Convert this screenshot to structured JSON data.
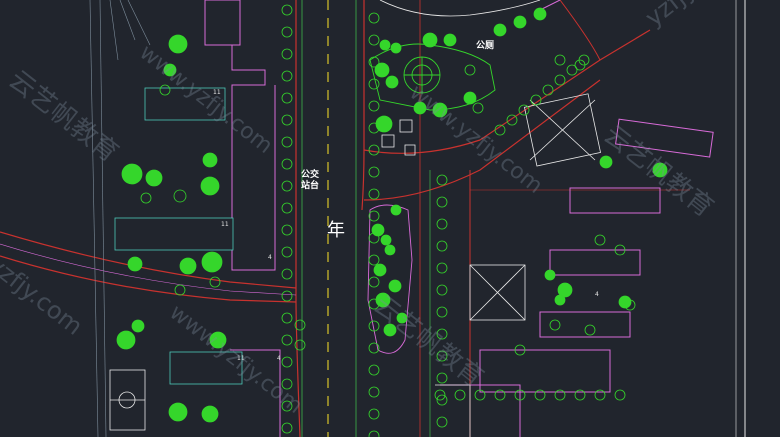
{
  "labels": {
    "bus_stop_line1": "公交",
    "bus_stop_line2": "站台",
    "park": "公厕",
    "road_char": "年",
    "building_numbers": [
      "11",
      "4",
      "11",
      "4",
      "11",
      "4"
    ]
  },
  "watermarks": [
    "www.yzfjy.com",
    "云艺帆教育",
    "yzfjy.com",
    "www.yzfjy.com",
    "云艺帆教育",
    "yzfjy.com",
    "www.yzfjy.com",
    "云艺帆教育"
  ],
  "colors": {
    "background": "#21252d",
    "building_magenta": "#d86bd8",
    "road_red": "#c8322e",
    "tree_green": "#35d62b",
    "outline_white": "#e8e8e8",
    "centerline_yellow": "#d8c32a",
    "curb_green": "#3fb54a"
  }
}
